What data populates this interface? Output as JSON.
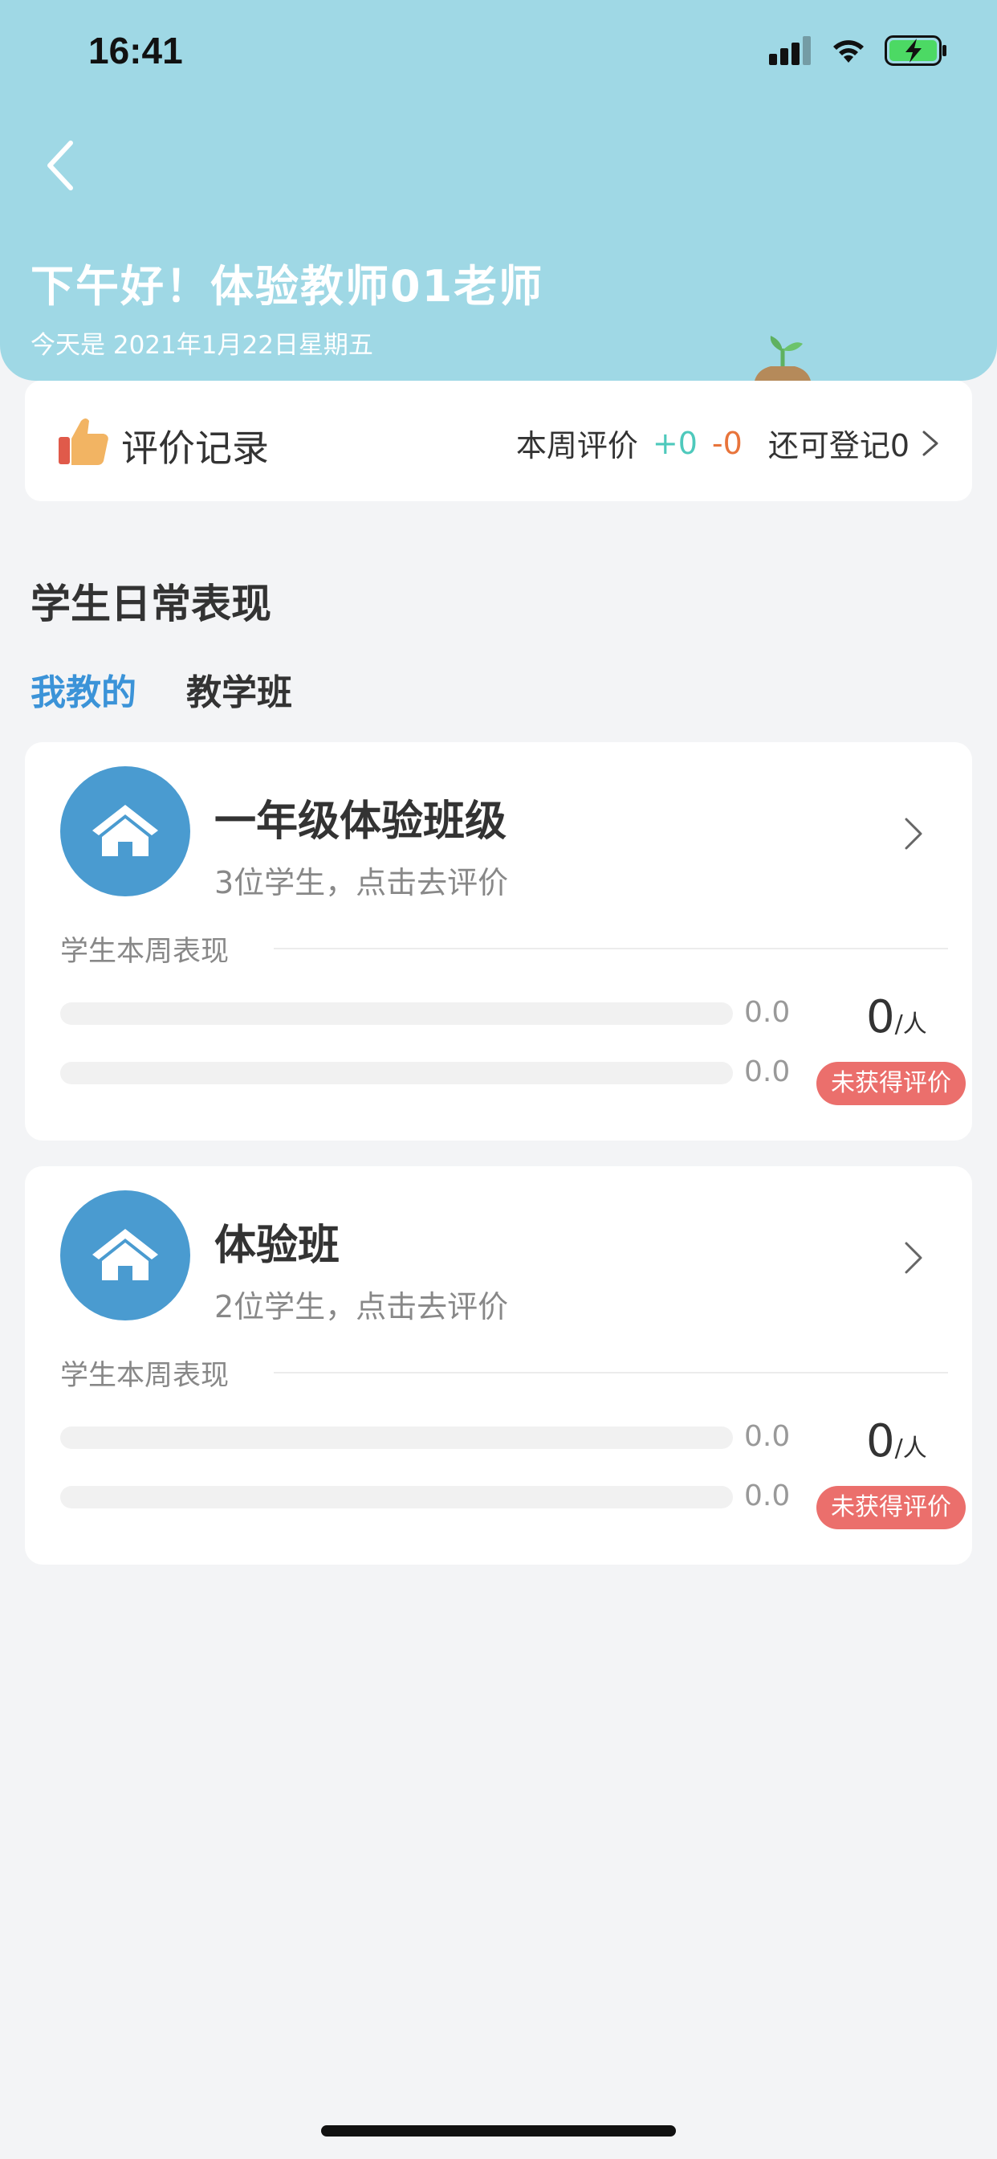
{
  "status_bar": {
    "time": "16:41"
  },
  "header": {
    "greeting": "下午好！体验教师01老师",
    "date": "今天是 2021年1月22日星期五"
  },
  "evaluation_record": {
    "title": "评价记录",
    "weekly_label": "本周评价",
    "plus": "+0",
    "minus": "-0",
    "remaining": "还可登记0"
  },
  "section": {
    "title": "学生日常表现",
    "tabs": [
      {
        "label": "我教的",
        "active": true
      },
      {
        "label": "教学班",
        "active": false
      }
    ]
  },
  "classes": [
    {
      "name": "一年级体验班级",
      "subtitle": "3位学生，点击去评价",
      "perf_label": "学生本周表现",
      "positive_value": "0.0",
      "negative_value": "0.0",
      "positive_fraction": 0,
      "negative_fraction": 0,
      "count": "0",
      "count_unit": "/人",
      "badge": "未获得评价"
    },
    {
      "name": "体验班",
      "subtitle": "2位学生，点击去评价",
      "perf_label": "学生本周表现",
      "positive_value": "0.0",
      "negative_value": "0.0",
      "positive_fraction": 0,
      "negative_fraction": 0,
      "count": "0",
      "count_unit": "/人",
      "badge": "未获得评价"
    }
  ],
  "colors": {
    "header_bg": "#9fd8e5",
    "accent_blue": "#3b93d8",
    "plus_green": "#4ec9bc",
    "minus_orange": "#e8743b",
    "badge_red": "#eb6f6c",
    "avatar_blue": "#4a9bd0"
  }
}
